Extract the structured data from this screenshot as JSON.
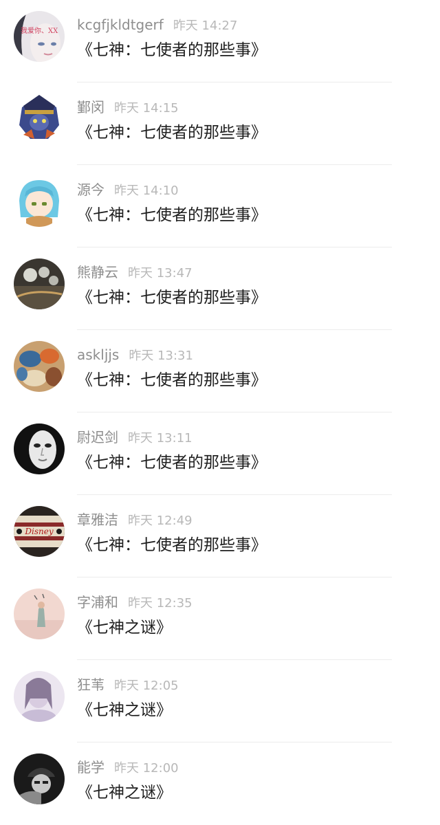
{
  "messages": [
    {
      "user": "kcgfjkldtgerf",
      "time": "昨天 14:27",
      "text": "《七神：七使者的那些事》",
      "avatar_text": "我爱你、XX",
      "avatar_icon": "pale-girl-avatar-icon"
    },
    {
      "user": "鄞闵",
      "time": "昨天 14:15",
      "text": "《七神：七使者的那些事》",
      "avatar_icon": "masked-character-avatar-icon"
    },
    {
      "user": "源今",
      "time": "昨天 14:10",
      "text": "《七神：七使者的那些事》",
      "avatar_icon": "anime-girl-avatar-icon"
    },
    {
      "user": "熊静云",
      "time": "昨天 13:47",
      "text": "《七神：七使者的那些事》",
      "avatar_icon": "wind-chime-avatar-icon"
    },
    {
      "user": "askljjs",
      "time": "昨天 13:31",
      "text": "《七神：七使者的那些事》",
      "avatar_icon": "seashells-avatar-icon"
    },
    {
      "user": "尉迟剑",
      "time": "昨天 13:11",
      "text": "《七神：七使者的那些事》",
      "avatar_icon": "white-mask-avatar-icon"
    },
    {
      "user": "章雅洁",
      "time": "昨天 12:49",
      "text": "《七神：七使者的那些事》",
      "avatar_text": "Disney",
      "avatar_icon": "disney-sign-avatar-icon"
    },
    {
      "user": "字浦和",
      "time": "昨天 12:35",
      "text": "《七神之谜》",
      "avatar_icon": "pastel-figure-avatar-icon"
    },
    {
      "user": "狂苇",
      "time": "昨天 12:05",
      "text": "《七神之谜》",
      "avatar_icon": "soft-portrait-avatar-icon"
    },
    {
      "user": "能学",
      "time": "昨天 12:00",
      "text": "《七神之谜》",
      "avatar_icon": "boy-in-cap-avatar-icon"
    }
  ]
}
